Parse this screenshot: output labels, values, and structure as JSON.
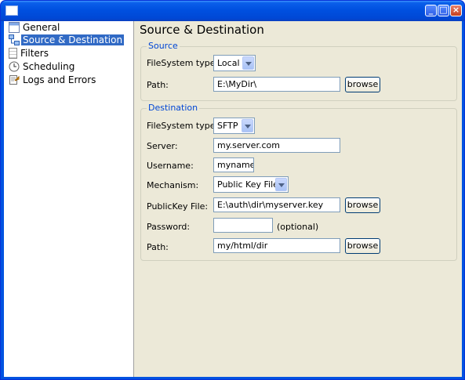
{
  "window": {
    "title": ""
  },
  "tree": {
    "items": [
      {
        "label": "General",
        "icon": "general-icon"
      },
      {
        "label": "Source & Destination",
        "icon": "network-icon",
        "selected": true
      },
      {
        "label": "Filters",
        "icon": "document-icon"
      },
      {
        "label": "Scheduling",
        "icon": "clock-icon"
      },
      {
        "label": "Logs and Errors",
        "icon": "log-icon"
      }
    ]
  },
  "page": {
    "title": "Source & Destination",
    "source": {
      "group_title": "Source",
      "fs_type_label": "FileSystem type:",
      "fs_type_value": "Local",
      "path_label": "Path:",
      "path_value": "E:\\MyDir\\",
      "browse_label": "browse"
    },
    "destination": {
      "group_title": "Destination",
      "fs_type_label": "FileSystem type:",
      "fs_type_value": "SFTP",
      "server_label": "Server:",
      "server_value": "my.server.com",
      "username_label": "Username:",
      "username_value": "myname",
      "mechanism_label": "Mechanism:",
      "mechanism_value": "Public Key File",
      "pubkey_label": "PublicKey File:",
      "pubkey_value": "E:\\auth\\dir\\myserver.key",
      "pubkey_browse_label": "browse",
      "password_label": "Password:",
      "password_value": "",
      "password_hint": "(optional)",
      "path_label": "Path:",
      "path_value": "my/html/dir",
      "path_browse_label": "browse"
    }
  }
}
